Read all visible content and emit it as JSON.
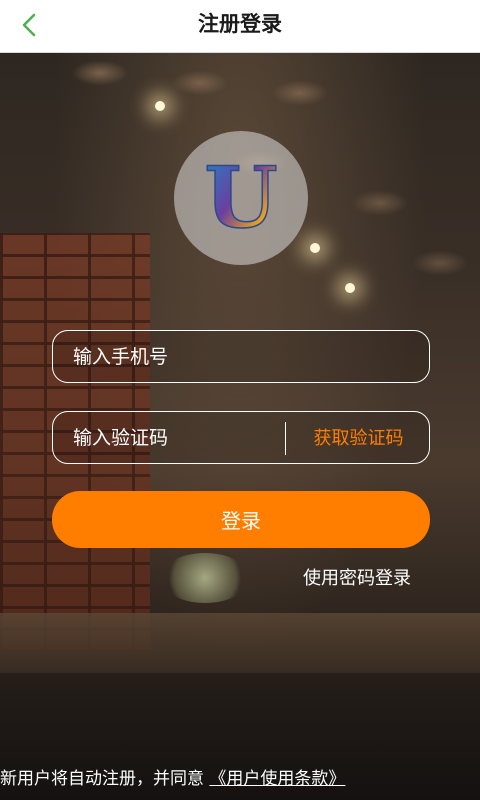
{
  "header": {
    "title": "注册登录",
    "back_icon": "chevron-left-icon"
  },
  "logo": {
    "letter": "U"
  },
  "form": {
    "phone_placeholder": "输入手机号",
    "code_placeholder": "输入验证码",
    "get_code_label": "获取验证码",
    "login_label": "登录",
    "password_login_label": "使用密码登录"
  },
  "footer": {
    "agreement_text": "新用户将自动注册，并同意",
    "terms_link": "《用户使用条款》"
  },
  "colors": {
    "accent": "#ff7e00",
    "back_icon": "#4caf50",
    "topbar": "#ffffff"
  }
}
